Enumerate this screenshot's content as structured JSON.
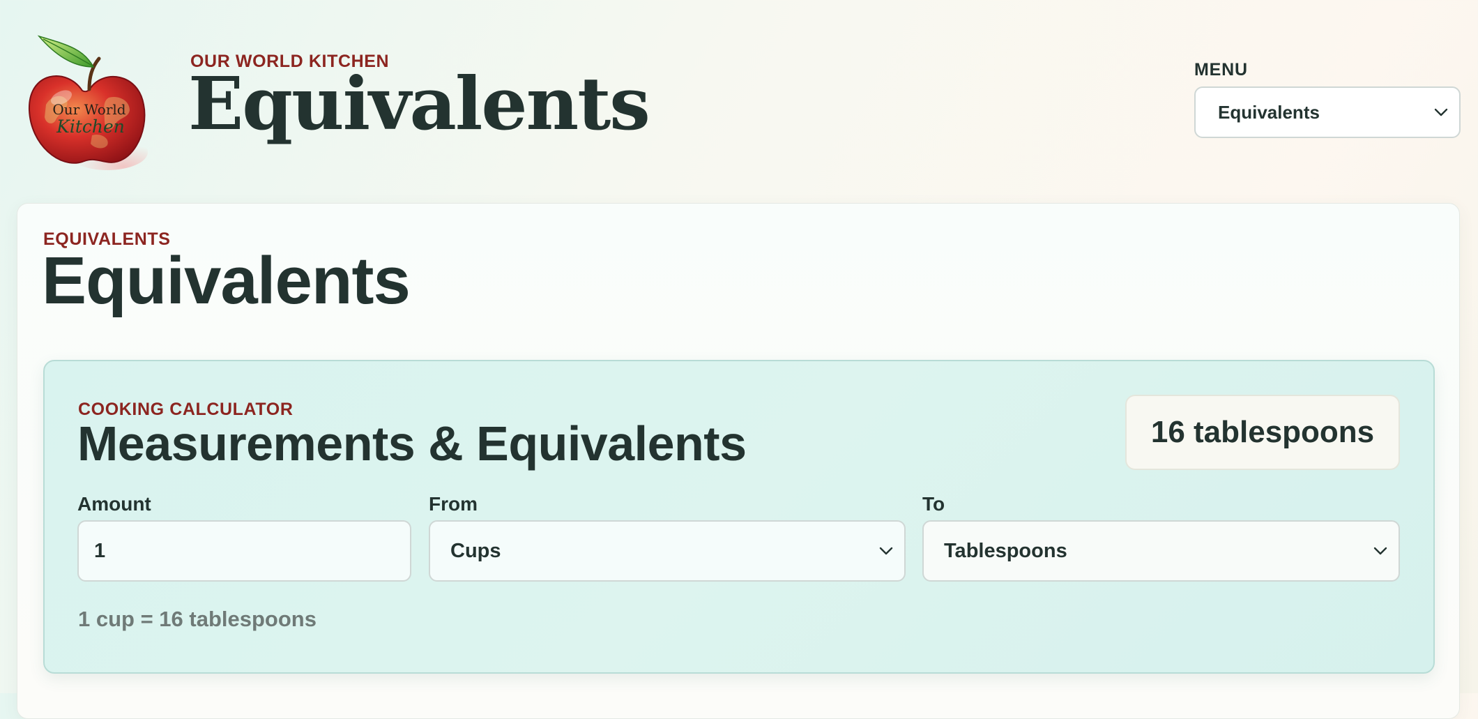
{
  "header": {
    "logo_text_line1": "Our World",
    "logo_text_line2": "Kitchen",
    "brand_label": "OUR WORLD KITCHEN",
    "site_title": "Equivalents",
    "menu": {
      "label": "MENU",
      "selected": "Equivalents"
    }
  },
  "main": {
    "section_label": "EQUIVALENTS",
    "title": "Equivalents",
    "calculator": {
      "eyebrow": "COOKING CALCULATOR",
      "title": "Measurements & Equivalents",
      "result": "16 tablespoons",
      "amount": {
        "label": "Amount",
        "value": "1"
      },
      "from": {
        "label": "From",
        "selected": "Cups"
      },
      "to": {
        "label": "To",
        "selected": "Tablespoons"
      },
      "equation": "1 cup = 16 tablespoons"
    }
  },
  "colors": {
    "accent_red": "#8c2520",
    "text_dark": "#233330",
    "calc_background": "#d9f3ef",
    "muted_text": "#6f7a77"
  },
  "icons": {
    "logo": "apple-globe-logo",
    "dropdown": "chevron-down-icon"
  }
}
